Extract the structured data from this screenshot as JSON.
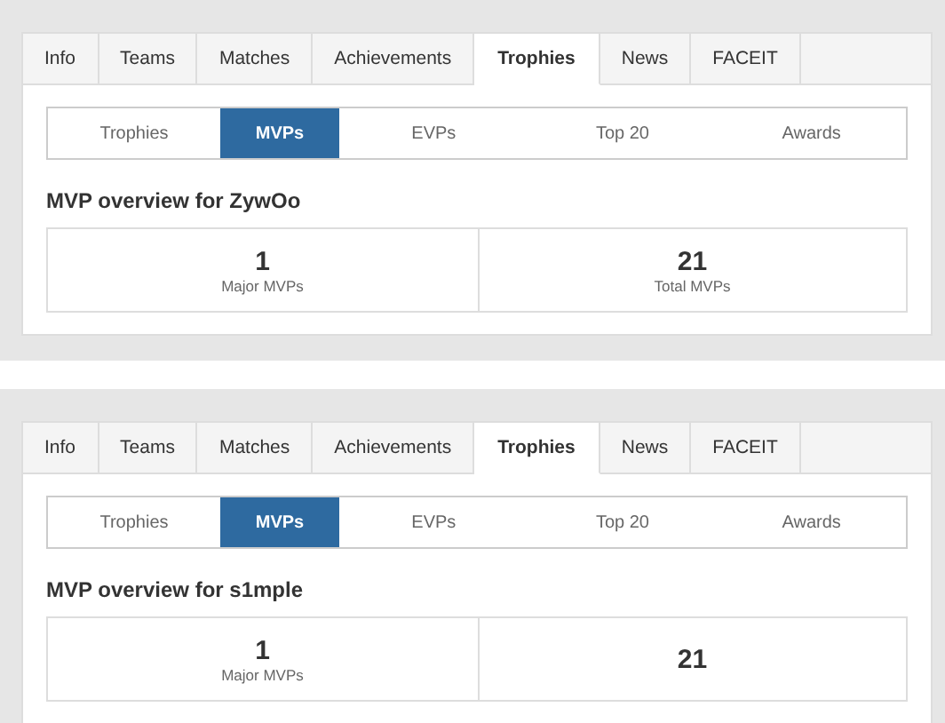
{
  "panels": [
    {
      "tabs": [
        {
          "label": "Info",
          "selected": false
        },
        {
          "label": "Teams",
          "selected": false
        },
        {
          "label": "Matches",
          "selected": false
        },
        {
          "label": "Achievements",
          "selected": false
        },
        {
          "label": "Trophies",
          "selected": true
        },
        {
          "label": "News",
          "selected": false
        },
        {
          "label": "FACEIT",
          "selected": false
        }
      ],
      "subtabs": [
        {
          "label": "Trophies",
          "selected": false
        },
        {
          "label": "MVPs",
          "selected": true
        },
        {
          "label": "EVPs",
          "selected": false
        },
        {
          "label": "Top 20",
          "selected": false
        },
        {
          "label": "Awards",
          "selected": false
        }
      ],
      "heading": "MVP overview for ZywOo",
      "stats": [
        {
          "value": "1",
          "label": "Major MVPs"
        },
        {
          "value": "21",
          "label": "Total MVPs"
        }
      ]
    },
    {
      "tabs": [
        {
          "label": "Info",
          "selected": false
        },
        {
          "label": "Teams",
          "selected": false
        },
        {
          "label": "Matches",
          "selected": false
        },
        {
          "label": "Achievements",
          "selected": false
        },
        {
          "label": "Trophies",
          "selected": true
        },
        {
          "label": "News",
          "selected": false
        },
        {
          "label": "FACEIT",
          "selected": false
        }
      ],
      "subtabs": [
        {
          "label": "Trophies",
          "selected": false
        },
        {
          "label": "MVPs",
          "selected": true
        },
        {
          "label": "EVPs",
          "selected": false
        },
        {
          "label": "Top 20",
          "selected": false
        },
        {
          "label": "Awards",
          "selected": false
        }
      ],
      "heading": "MVP overview for s1mple",
      "stats": [
        {
          "value": "1",
          "label": "Major MVPs"
        },
        {
          "value": "21"
        }
      ]
    }
  ]
}
